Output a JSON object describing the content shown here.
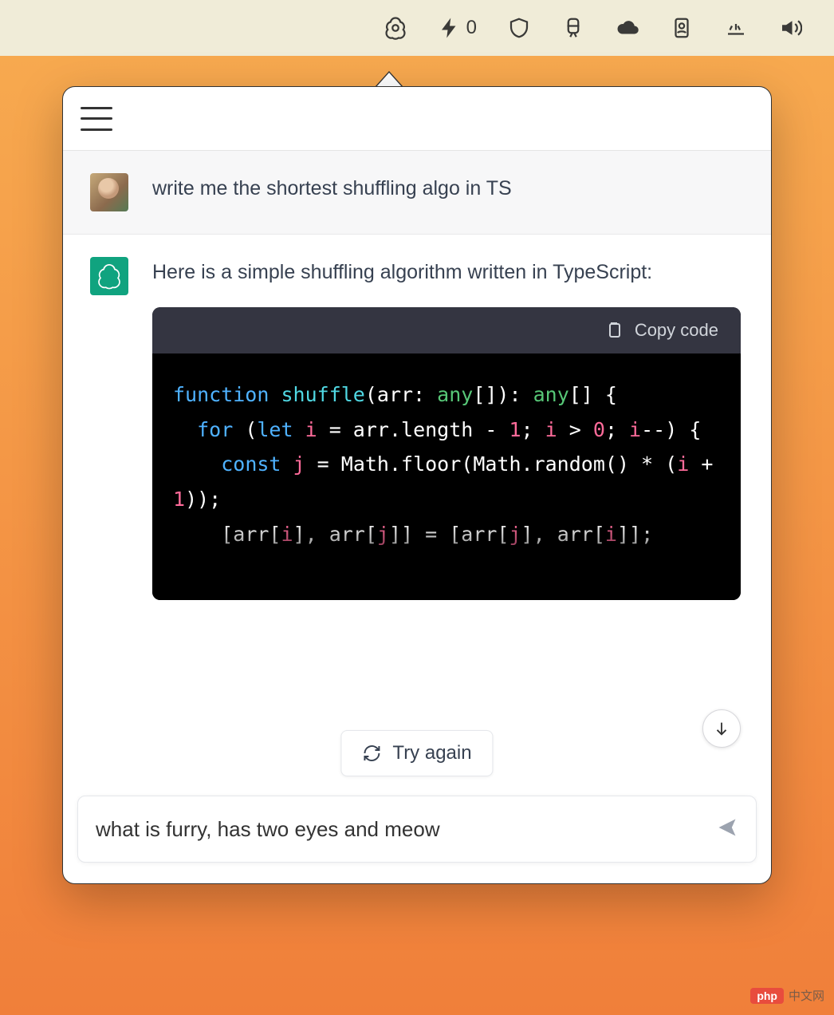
{
  "menubar": {
    "bolt_count": "0"
  },
  "chat": {
    "user_message": "write me the shortest shuffling algo in TS",
    "assistant_intro": "Here is a simple shuffling algorithm written in TypeScript:",
    "code": {
      "copy_label": "Copy code",
      "tok_function": "function",
      "tok_shuffle": "shuffle",
      "tok_arr_param": "arr: ",
      "tok_any1": "any",
      "tok_brackets_ret": "[]): ",
      "tok_any2": "any",
      "tok_ret_br": "[] {",
      "tok_for": "for",
      "tok_let": "let",
      "tok_i": "i",
      "tok_eq1": " = arr.length - ",
      "tok_one_a": "1",
      "tok_semi1": "; ",
      "tok_i2": "i",
      "tok_gt": " > ",
      "tok_zero": "0",
      "tok_semi2": "; ",
      "tok_i3": "i",
      "tok_dec": "--) {",
      "tok_const": "const",
      "tok_j": "j",
      "tok_eq2": " = Math.floor(Math.random() * (",
      "tok_i4": "i",
      "tok_plus": " + ",
      "tok_one_b": "1",
      "tok_close1": "));",
      "tok_swap1a": "[arr[",
      "tok_i5": "i",
      "tok_swap1b": "], arr[",
      "tok_j2": "j",
      "tok_swap1c": "]] = [arr[",
      "tok_j3": "j",
      "tok_swap1d": "], arr[",
      "tok_i6": "i",
      "tok_swap1e": "]];"
    }
  },
  "controls": {
    "try_again": "Try again"
  },
  "composer": {
    "value": "what is furry, has two eyes and meow"
  },
  "watermark": {
    "badge": "php",
    "text": "中文网"
  }
}
